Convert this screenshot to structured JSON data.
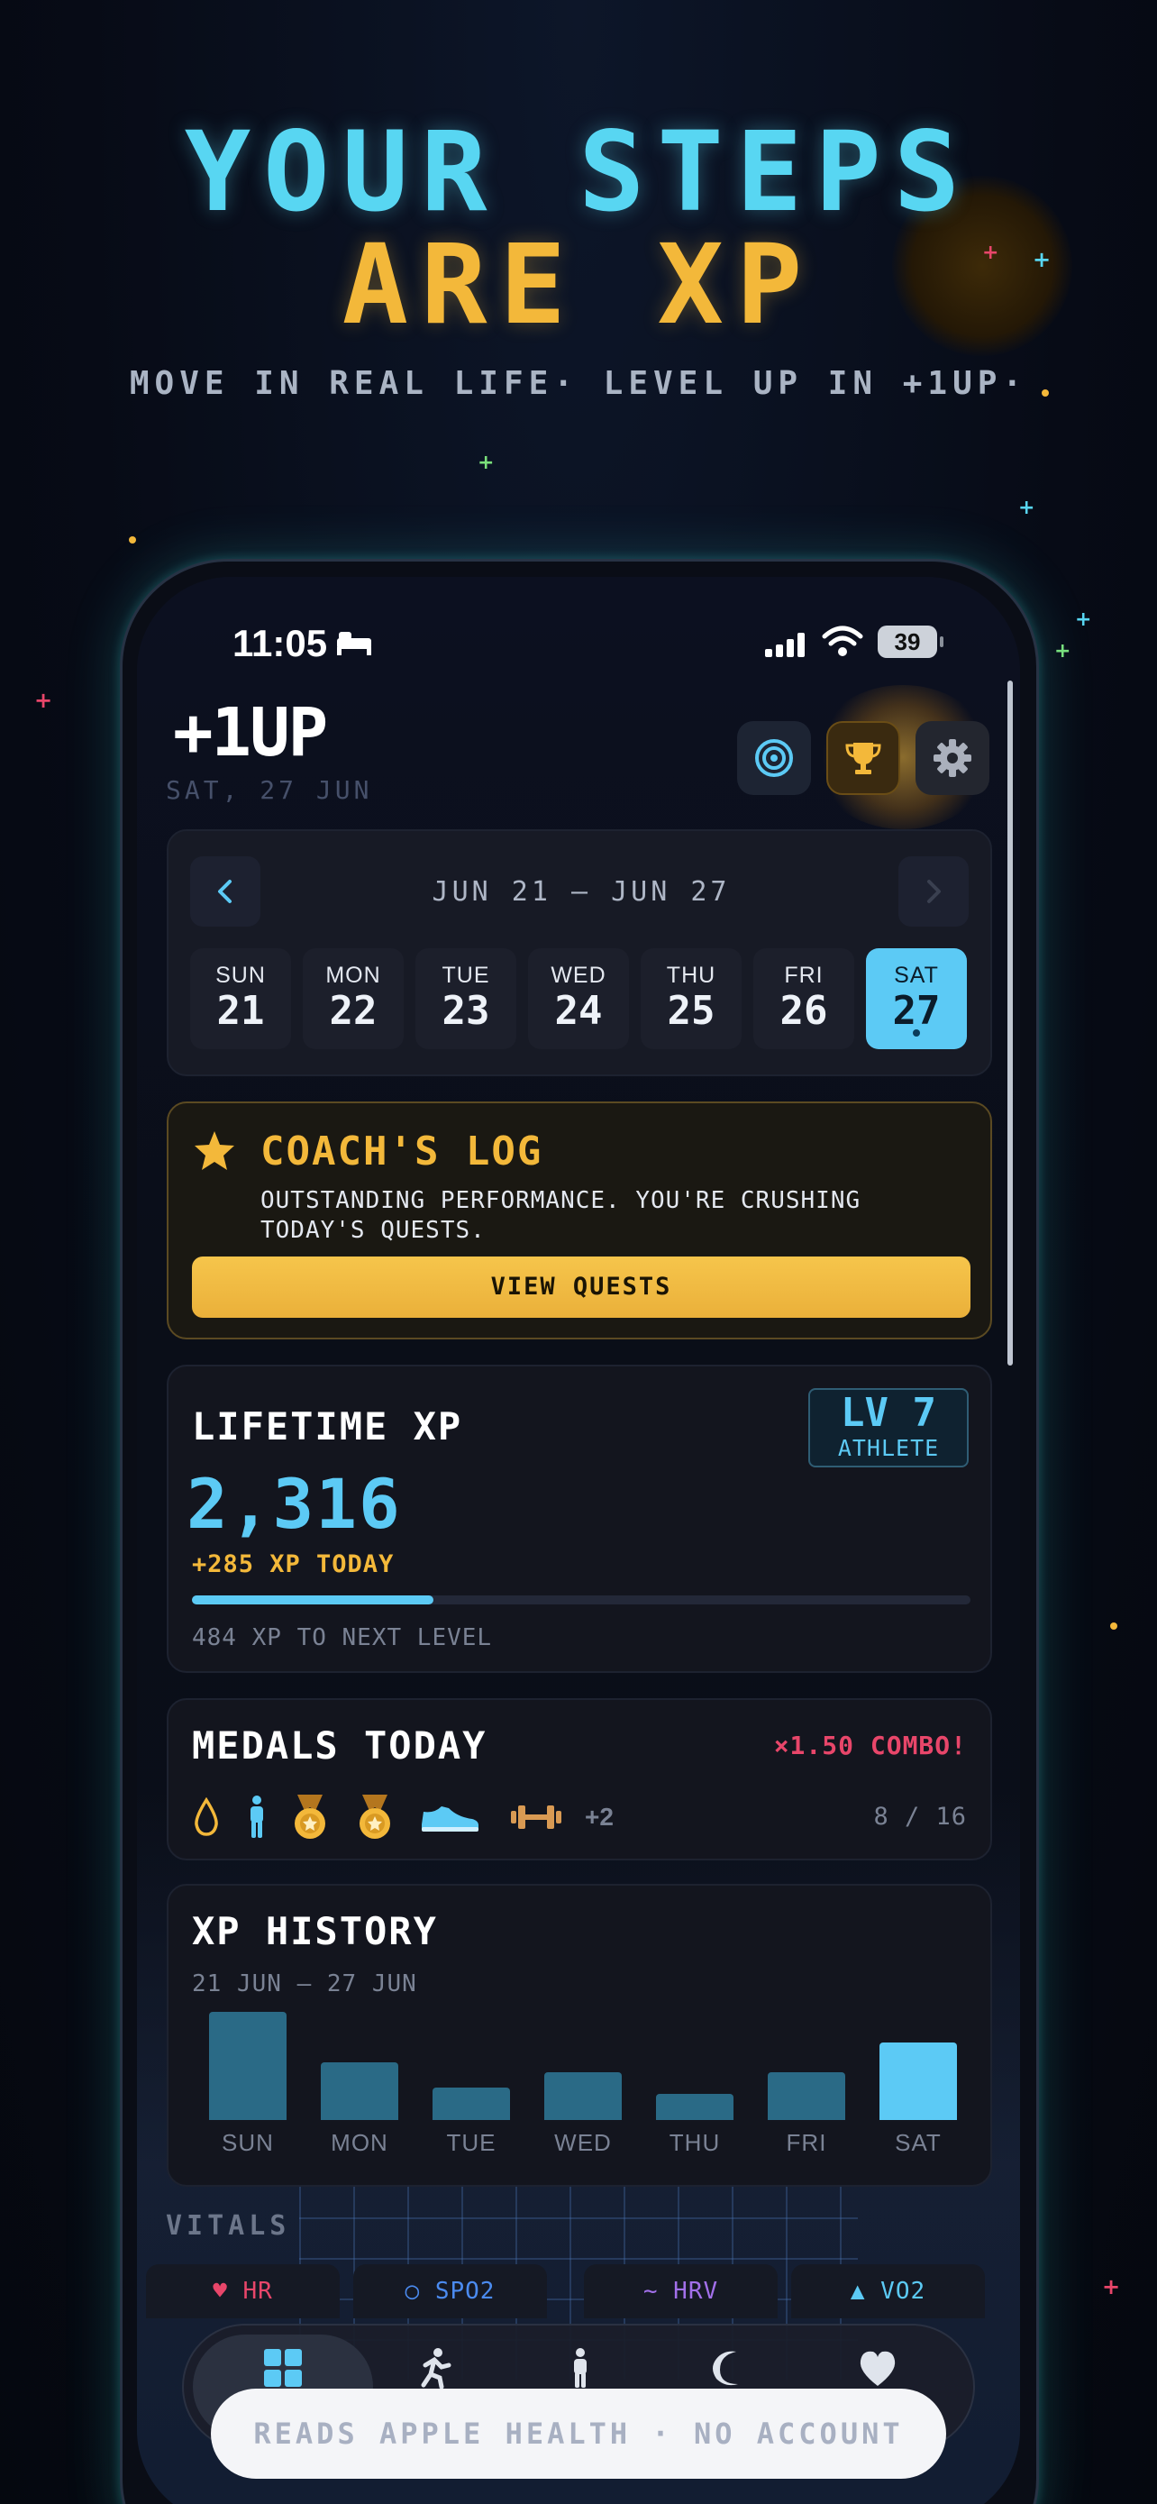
{
  "hero": {
    "line1": "YOUR STEPS",
    "line2": "ARE XP",
    "tagline": "MOVE IN REAL LIFE·  LEVEL UP IN +1UP·"
  },
  "status_bar": {
    "time": "11:05",
    "battery": "39"
  },
  "header": {
    "app_title": "+1UP",
    "date": "SAT, 27 JUN",
    "buttons": [
      "target-icon",
      "trophy-icon",
      "gear-icon"
    ]
  },
  "week": {
    "range": "JUN 21 — JUN 27",
    "days": [
      {
        "name": "SUN",
        "date": "21"
      },
      {
        "name": "MON",
        "date": "22"
      },
      {
        "name": "TUE",
        "date": "23"
      },
      {
        "name": "WED",
        "date": "24"
      },
      {
        "name": "THU",
        "date": "25"
      },
      {
        "name": "FRI",
        "date": "26"
      },
      {
        "name": "SAT",
        "date": "27"
      }
    ],
    "selected": "SAT"
  },
  "coach": {
    "title": "COACH'S LOG",
    "message": "OUTSTANDING PERFORMANCE. YOU'RE CRUSHING TODAY'S QUESTS.",
    "button": "VIEW QUESTS"
  },
  "lifetime": {
    "title": "LIFETIME XP",
    "level": "LV 7",
    "rank": "ATHLETE",
    "xp": "2,316",
    "today": "+285 XP TODAY",
    "progress": 0.31,
    "next": "484 XP TO NEXT LEVEL"
  },
  "medals": {
    "title": "MEDALS TODAY",
    "combo": "×1.50 COMBO!",
    "icons": [
      "water-drop-icon",
      "person-standing-icon",
      "medal-icon",
      "medal-icon",
      "sneaker-icon",
      "dumbbell-icon"
    ],
    "more": "+2",
    "count": "8 / 16"
  },
  "history": {
    "title": "XP HISTORY",
    "range": "21 JUN — 27 JUN"
  },
  "chart_data": {
    "type": "bar",
    "categories": [
      "SUN",
      "MON",
      "TUE",
      "WED",
      "THU",
      "FRI",
      "SAT"
    ],
    "values": [
      100,
      53,
      30,
      44,
      24,
      44,
      72
    ],
    "highlight": "SAT",
    "colors": {
      "bar": "#2a6a86",
      "highlight": "#5ccaf5"
    }
  },
  "vitals": {
    "title": "VITALS",
    "tags": [
      "♥ HR",
      "○ SPO2",
      "~ HRV",
      "▲ VO2"
    ]
  },
  "footer_pill": "READS APPLE HEALTH · NO ACCOUNT",
  "colors": {
    "accent_cyan": "#5ccaf5",
    "accent_gold": "#f3b83a",
    "combo_red": "#e8466a"
  }
}
